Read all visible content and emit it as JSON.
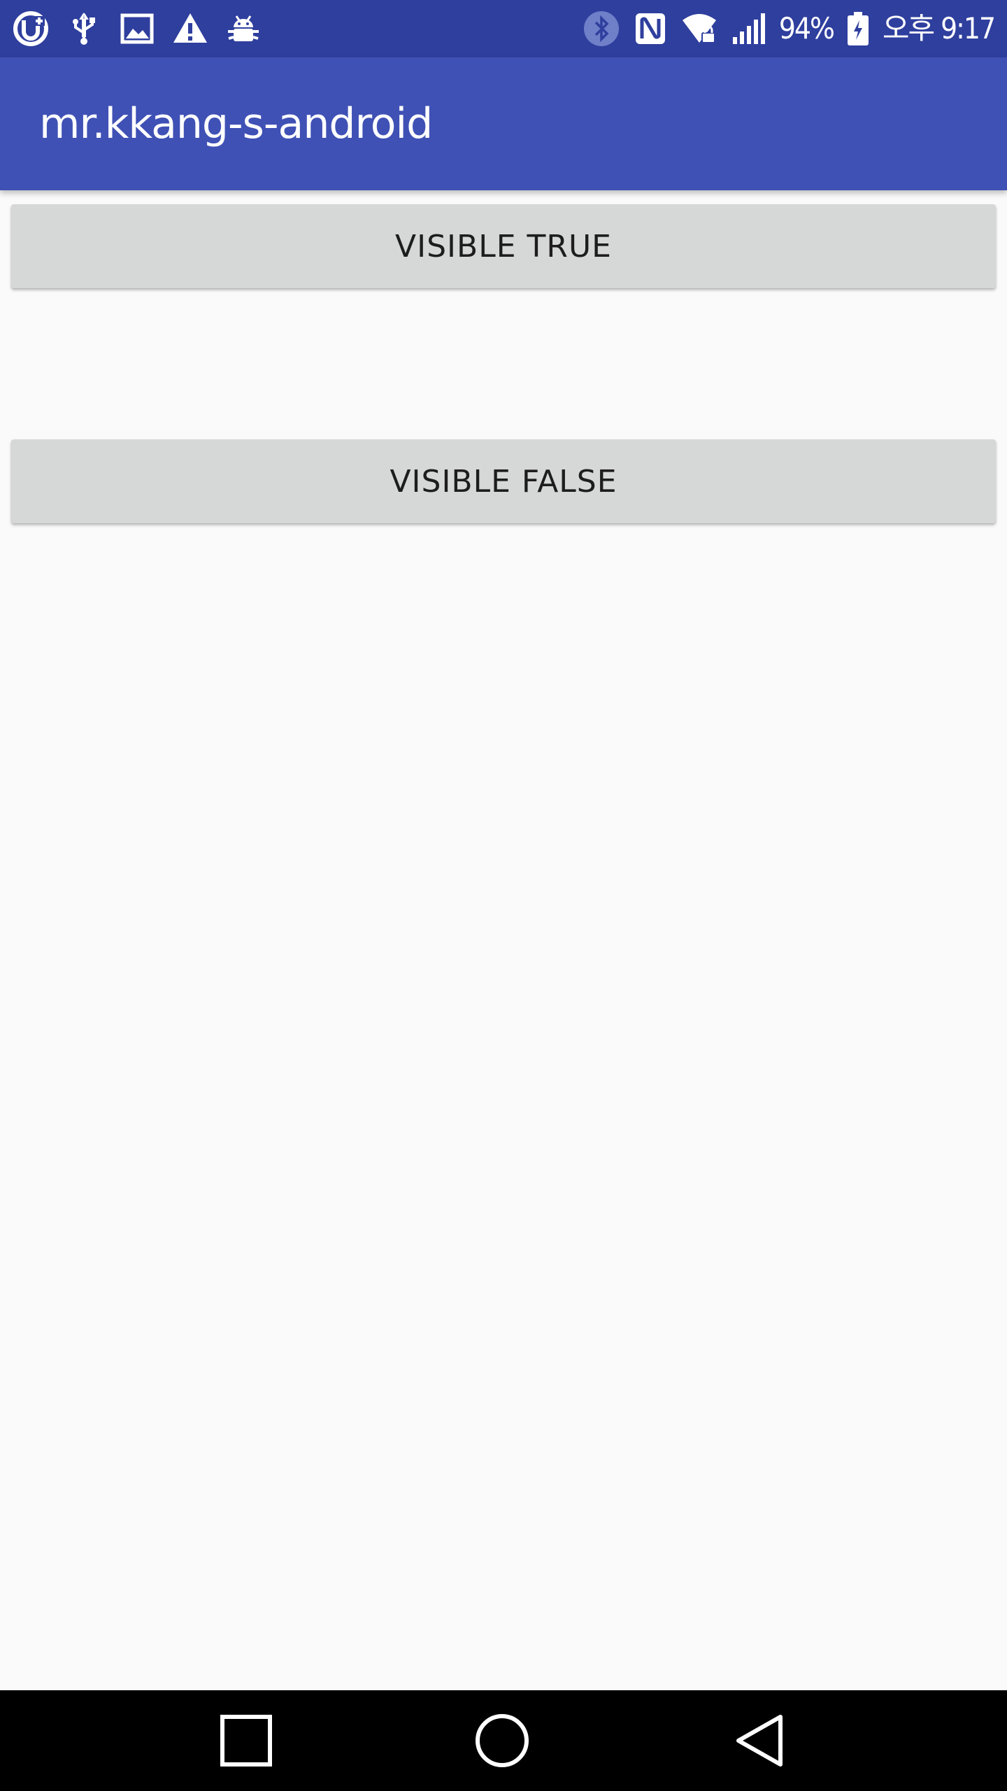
{
  "status_bar": {
    "left_icons": [
      "u-plus-icon",
      "usb-icon",
      "image-icon",
      "warning-icon",
      "android-debug-icon"
    ],
    "right_icons": [
      "bluetooth-icon",
      "nfc-icon",
      "wifi-lock-icon",
      "signal-icon",
      "battery-icon"
    ],
    "battery_percent": "94%",
    "time": "오후 9:17",
    "background_color": "#2f3f9e"
  },
  "app_bar": {
    "title": "mr.kkang-s-android",
    "background_color": "#3f51b5"
  },
  "buttons": {
    "visible_true_label": "VISIBLE TRUE",
    "visible_false_label": "VISIBLE FALSE",
    "background_color": "#d6d7d7"
  },
  "nav_bar": {
    "items": [
      "recent-apps-icon",
      "home-icon",
      "back-icon"
    ],
    "background_color": "#000000"
  }
}
